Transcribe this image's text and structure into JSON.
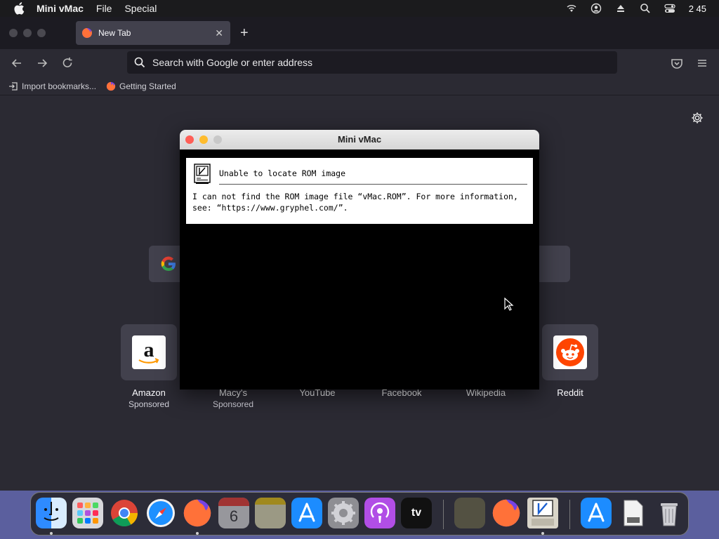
{
  "menubar": {
    "app_name": "Mini vMac",
    "items": [
      "File",
      "Special"
    ],
    "clock": "2 45"
  },
  "browser": {
    "tab_title": "New Tab",
    "url_placeholder": "Search with Google or enter address",
    "bookmarks": [
      "Import bookmarks...",
      "Getting Started"
    ]
  },
  "shortcuts": [
    {
      "name": "Amazon",
      "sub": "Sponsored"
    },
    {
      "name": "Macy's",
      "sub": "Sponsored"
    },
    {
      "name": "YouTube",
      "sub": ""
    },
    {
      "name": "Facebook",
      "sub": ""
    },
    {
      "name": "Wikipedia",
      "sub": ""
    },
    {
      "name": "Reddit",
      "sub": ""
    }
  ],
  "vmac": {
    "title": "Mini vMac",
    "alert_title": "Unable to locate ROM image",
    "alert_message": "I can not find the ROM image file “vMac.ROM”. For more information, see: “https://www.gryphel.com/”."
  },
  "colors": {
    "accent": "#ff9500",
    "close": "#ff5f57",
    "minimize": "#febc2e"
  }
}
